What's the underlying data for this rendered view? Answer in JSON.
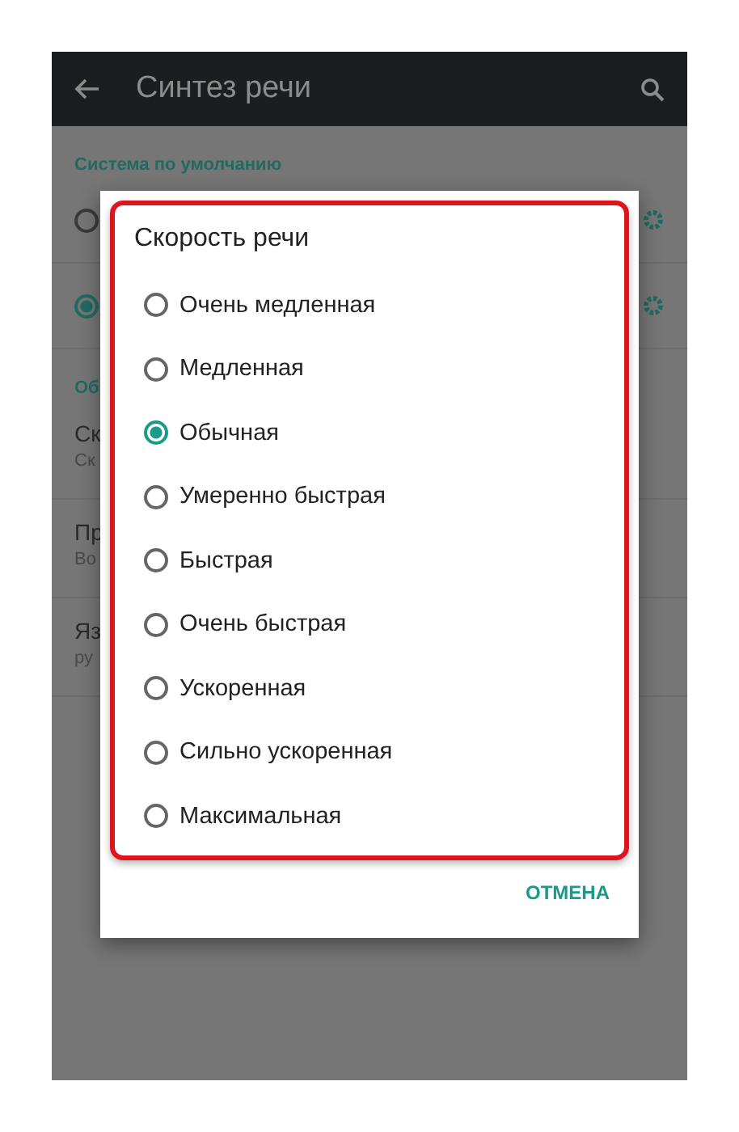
{
  "app_bar": {
    "title": "Синтез речи"
  },
  "settings": {
    "section_header": "Система по умолчанию",
    "engines": [
      {
        "selected": false
      },
      {
        "selected": true
      }
    ],
    "section_header_2": "Об",
    "items": [
      {
        "title": "Ск",
        "subtitle": "Ск"
      },
      {
        "title": "Пр",
        "subtitle": "Во"
      },
      {
        "title": "Яз",
        "subtitle": "ру"
      }
    ]
  },
  "dialog": {
    "title": "Скорость речи",
    "options": [
      {
        "label": "Очень медленная",
        "selected": false
      },
      {
        "label": "Медленная",
        "selected": false
      },
      {
        "label": "Обычная",
        "selected": true
      },
      {
        "label": "Умеренно быстрая",
        "selected": false
      },
      {
        "label": "Быстрая",
        "selected": false
      },
      {
        "label": "Очень быстрая",
        "selected": false
      },
      {
        "label": "Ускоренная",
        "selected": false
      },
      {
        "label": "Сильно ускоренная",
        "selected": false
      },
      {
        "label": "Максимальная",
        "selected": false
      }
    ],
    "button": "ОТМЕНА"
  }
}
